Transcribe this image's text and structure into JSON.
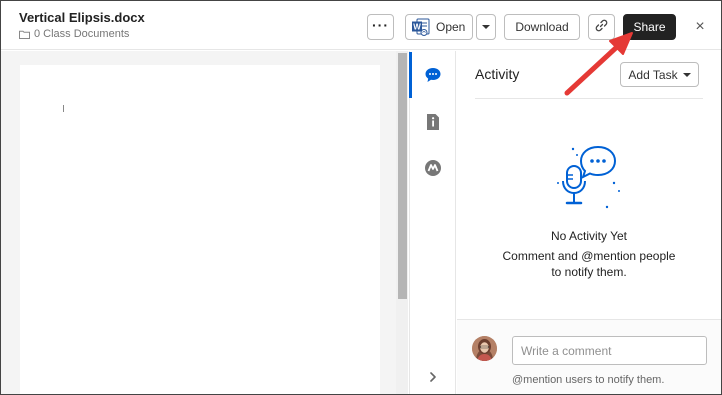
{
  "header": {
    "file_name": "Vertical Elipsis.docx",
    "folder_name": "0 Class Documents",
    "more_label": "···",
    "open_label": "Open",
    "download_label": "Download",
    "share_label": "Share",
    "close_label": "×"
  },
  "activity": {
    "title": "Activity",
    "add_task_label": "Add Task",
    "empty_title": "No Activity Yet",
    "empty_description": "Comment and @mention people to notify them."
  },
  "composer": {
    "placeholder": "Write a comment",
    "hint": "@mention users to notify them."
  },
  "colors": {
    "accent": "#0061d5",
    "share_button": "#222222",
    "annotation_arrow": "#e53935"
  },
  "icons": {
    "folder": "folder-icon",
    "word": "word-icon",
    "link": "link-icon",
    "activity": "chat-bubble-icon",
    "details": "info-icon",
    "skills": "box-skills-icon",
    "expand": "chevron-right-icon",
    "illustration": "microphone-speech-icon"
  }
}
